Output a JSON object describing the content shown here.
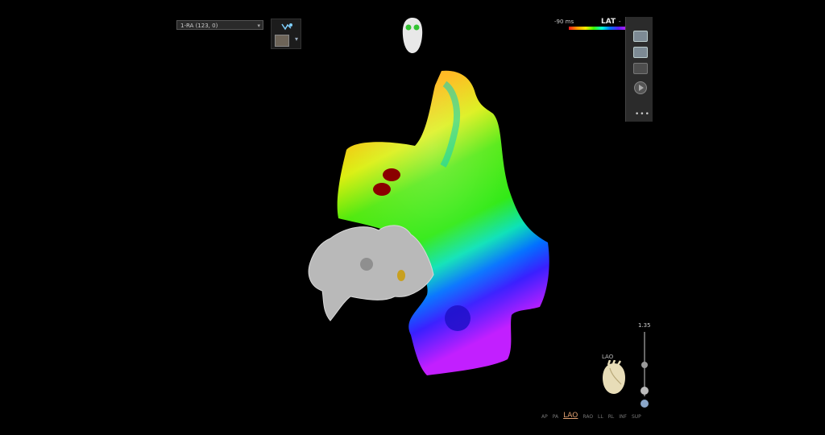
{
  "map_selector": {
    "value": "1-RA (123, 0)"
  },
  "lat_scale": {
    "label": "LAT",
    "min": "-90 ms",
    "max": "-"
  },
  "toolbar": {
    "more_label": "•••"
  },
  "zoom": {
    "value": "1.35"
  },
  "orientation": {
    "current": "LAO"
  },
  "views": [
    "AP",
    "PA",
    "LAO",
    "RAO",
    "LL",
    "RL",
    "INF",
    "SUP"
  ],
  "colors": {
    "lat_early": "#ff1a1a",
    "lat_mid": "#3cff00",
    "lat_late": "#c61fff",
    "active_view": "#e0a070"
  }
}
